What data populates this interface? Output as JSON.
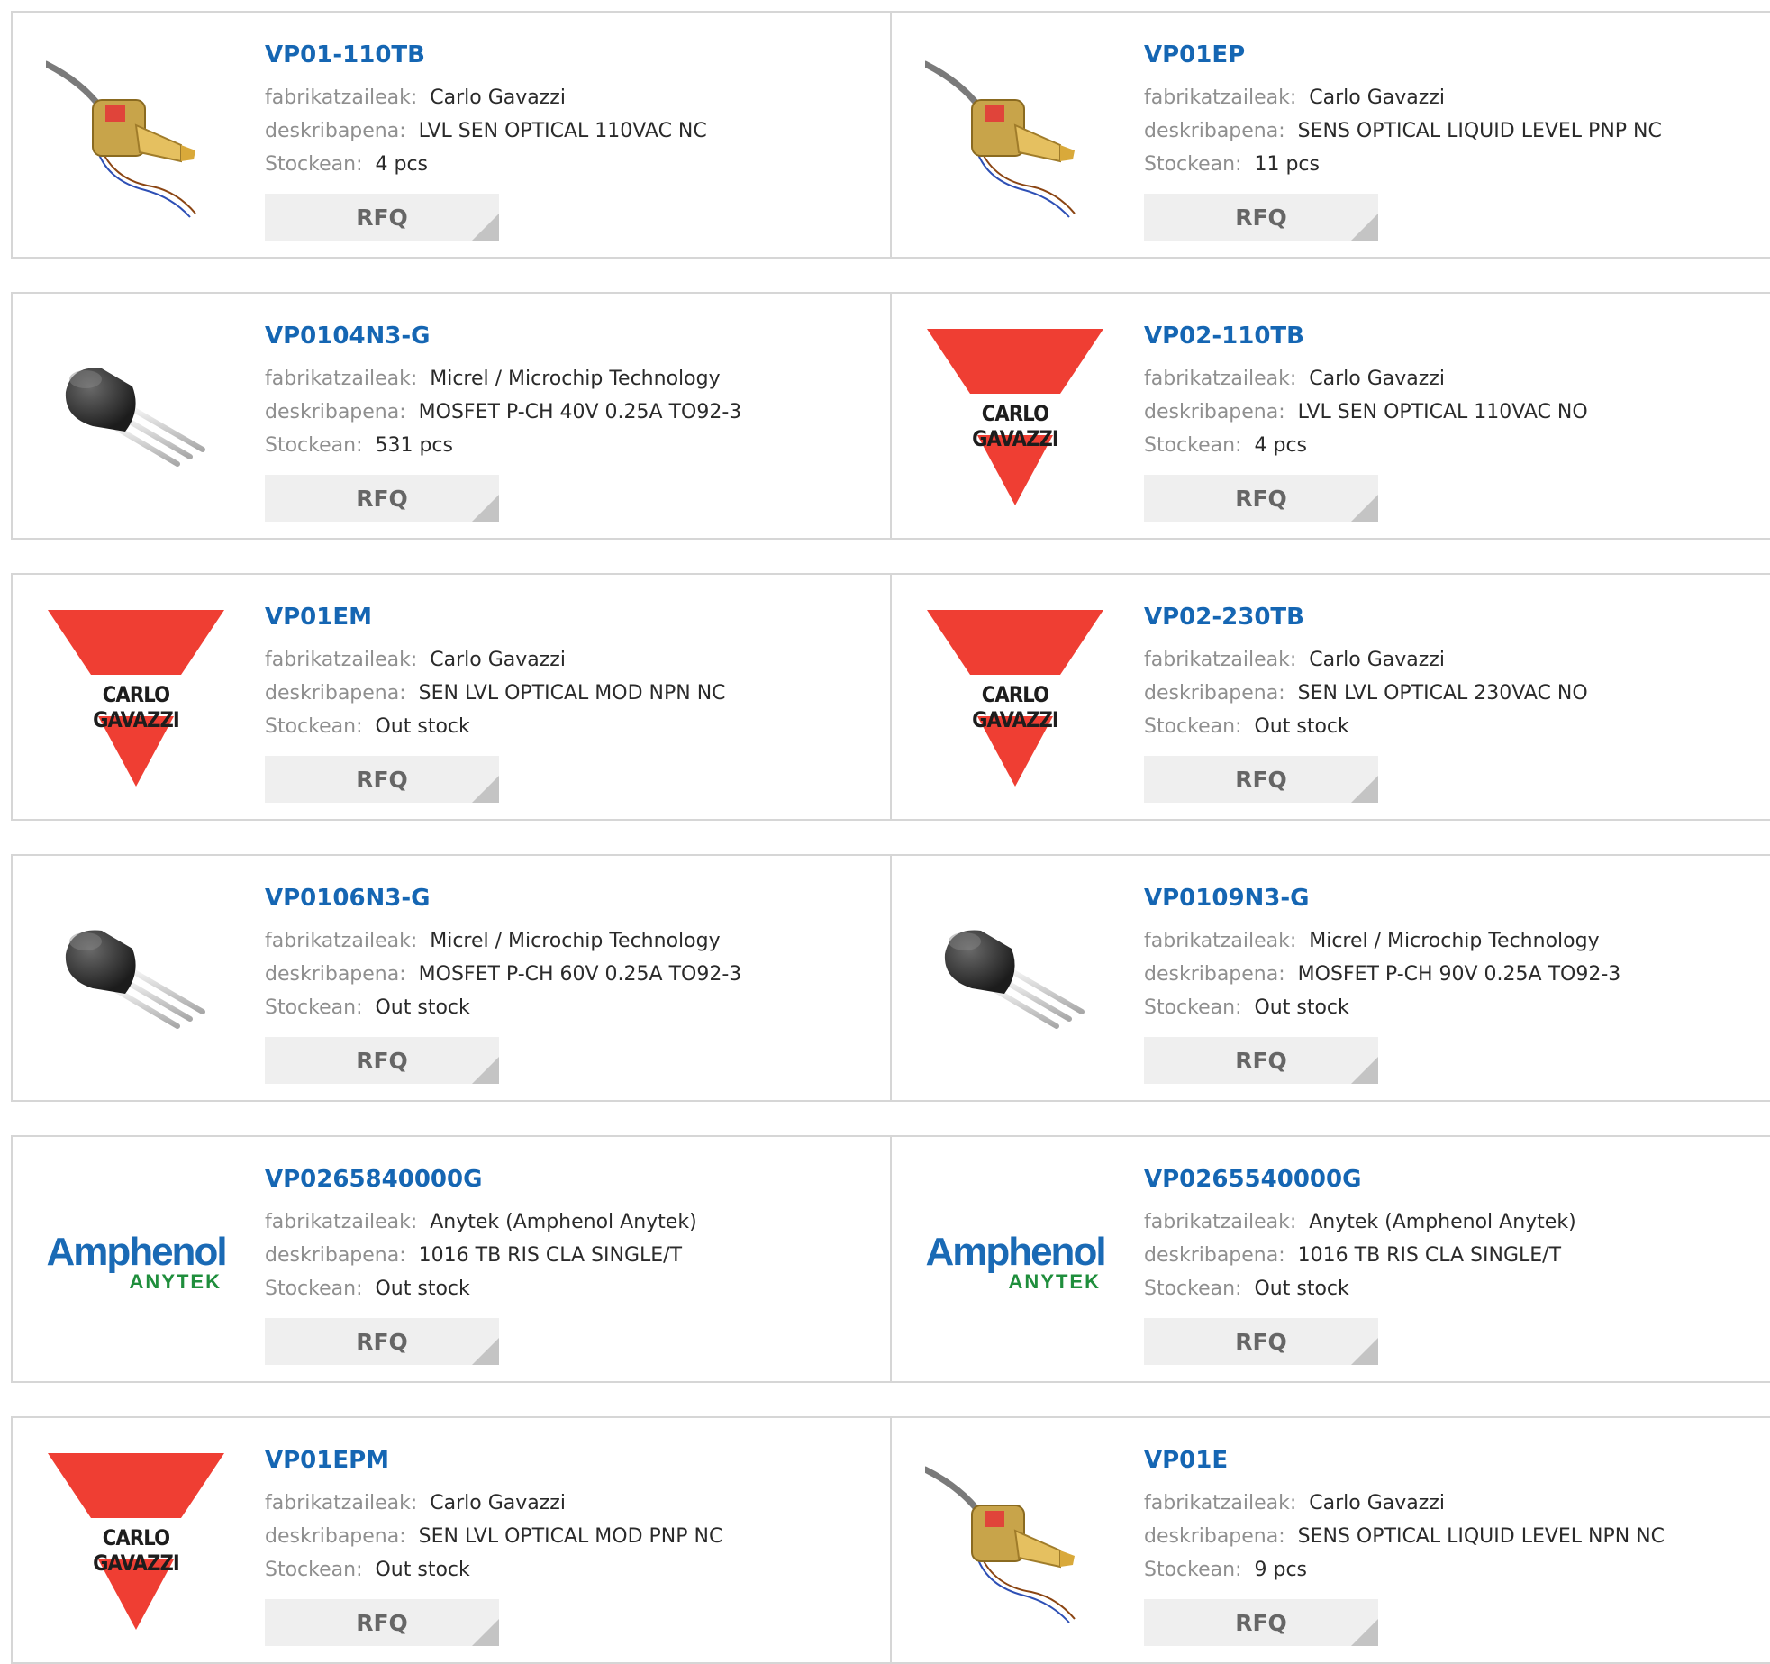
{
  "labels": {
    "manufacturer": "fabrikatzaileak:",
    "description": "deskribapena:",
    "stock": "Stockean:",
    "rfq": "RFQ"
  },
  "logos": {
    "carlo_gavazzi": "CARLO GAVAZZI",
    "amphenol": "Amphenol",
    "anytek": "ANYTEK"
  },
  "colors": {
    "part_link": "#1566b3",
    "cg_red": "#ef3e33",
    "amphenol_blue": "#1a6ab5",
    "anytek_green": "#1f8e3c"
  },
  "products": [
    {
      "part": "VP01-110TB",
      "manufacturer": "Carlo Gavazzi",
      "description": "LVL SEN OPTICAL 110VAC NC",
      "stock": "4 pcs",
      "image": "level-sensor-icon"
    },
    {
      "part": "VP01EP",
      "manufacturer": "Carlo Gavazzi",
      "description": "SENS OPTICAL LIQUID LEVEL PNP NC",
      "stock": "11 pcs",
      "image": "level-sensor-icon"
    },
    {
      "part": "VP0104N3-G",
      "manufacturer": "Micrel / Microchip Technology",
      "description": "MOSFET P-CH 40V 0.25A TO92-3",
      "stock": "531 pcs",
      "image": "transistor-icon"
    },
    {
      "part": "VP02-110TB",
      "manufacturer": "Carlo Gavazzi",
      "description": "LVL SEN OPTICAL 110VAC NO",
      "stock": "4 pcs",
      "image": "carlo-gavazzi-logo"
    },
    {
      "part": "VP01EM",
      "manufacturer": "Carlo Gavazzi",
      "description": "SEN LVL OPTICAL MOD NPN NC",
      "stock": "Out stock",
      "image": "carlo-gavazzi-logo"
    },
    {
      "part": "VP02-230TB",
      "manufacturer": "Carlo Gavazzi",
      "description": "SEN LVL OPTICAL 230VAC NO",
      "stock": "Out stock",
      "image": "carlo-gavazzi-logo"
    },
    {
      "part": "VP0106N3-G",
      "manufacturer": "Micrel / Microchip Technology",
      "description": "MOSFET P-CH 60V 0.25A TO92-3",
      "stock": "Out stock",
      "image": "transistor-icon"
    },
    {
      "part": "VP0109N3-G",
      "manufacturer": "Micrel / Microchip Technology",
      "description": "MOSFET P-CH 90V 0.25A TO92-3",
      "stock": "Out stock",
      "image": "transistor-icon"
    },
    {
      "part": "VP0265840000G",
      "manufacturer": "Anytek (Amphenol Anytek)",
      "description": "1016 TB RIS CLA SINGLE/T",
      "stock": "Out stock",
      "image": "amphenol-anytek-logo"
    },
    {
      "part": "VP0265540000G",
      "manufacturer": "Anytek (Amphenol Anytek)",
      "description": "1016 TB RIS CLA SINGLE/T",
      "stock": "Out stock",
      "image": "amphenol-anytek-logo"
    },
    {
      "part": "VP01EPM",
      "manufacturer": "Carlo Gavazzi",
      "description": "SEN LVL OPTICAL MOD PNP NC",
      "stock": "Out stock",
      "image": "carlo-gavazzi-logo"
    },
    {
      "part": "VP01E",
      "manufacturer": "Carlo Gavazzi",
      "description": "SENS OPTICAL LIQUID LEVEL NPN NC",
      "stock": "9 pcs",
      "image": "level-sensor-icon"
    }
  ]
}
